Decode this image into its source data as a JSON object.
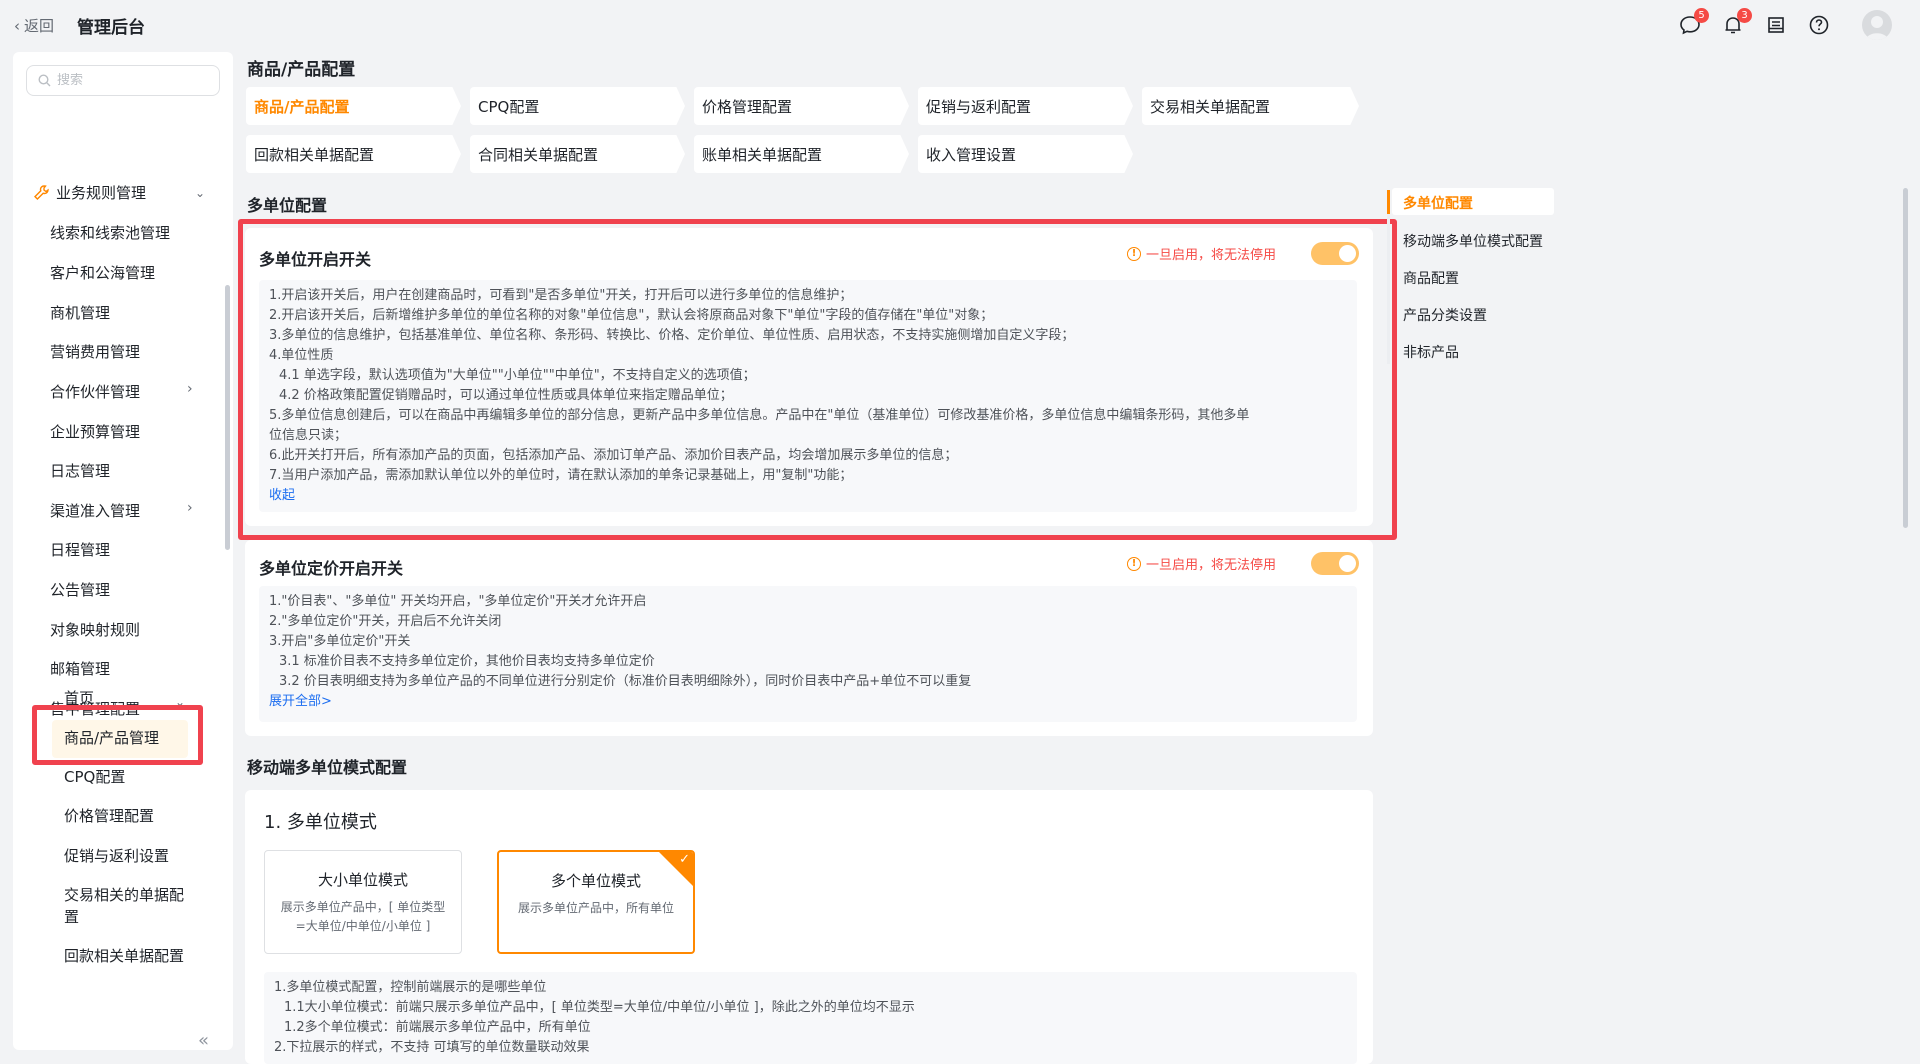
{
  "header": {
    "back_label": "返回",
    "title": "管理后台",
    "icons": [
      {
        "name": "message-icon",
        "badge": "5"
      },
      {
        "name": "bell-icon",
        "badge": "3"
      },
      {
        "name": "task-icon",
        "badge": ""
      },
      {
        "name": "help-icon",
        "badge": ""
      }
    ]
  },
  "sidebar": {
    "search_placeholder": "搜索",
    "group_label": "业务规则管理",
    "items": [
      "线索和线索池管理",
      "客户和公海管理",
      "商机管理",
      "营销费用管理",
      "合作伙伴管理",
      "企业预算管理",
      "日志管理",
      "渠道准入管理",
      "日程管理",
      "公告管理",
      "对象映射规则",
      "邮箱管理",
      "售中管理配置"
    ],
    "sub_items": [
      "首页",
      "商品/产品管理",
      "CPQ配置",
      "价格管理配置",
      "促销与返利设置",
      "交易相关的单据配置",
      "回款相关单据配置"
    ]
  },
  "main": {
    "page_title": "商品/产品配置",
    "tabs": [
      "商品/产品配置",
      "CPQ配置",
      "价格管理配置",
      "促销与返利配置",
      "交易相关单据配置",
      "回款相关单据配置",
      "合同相关单据配置",
      "账单相关单据配置",
      "收入管理设置"
    ],
    "section1_title": "多单位配置",
    "switch1": {
      "title": "多单位开启开关",
      "warning": "一旦启用，将无法停用",
      "enabled": true,
      "lines": [
        "1.开启该开关后，用户在创建商品时，可看到\"是否多单位\"开关，打开后可以进行多单位的信息维护；",
        "2.开启该开关后，后新增维护多单位的单位名称的对象\"单位信息\"，默认会将原商品对象下\"单位\"字段的值存储在\"单位\"对象；",
        "3.多单位的信息维护，包括基准单位、单位名称、条形码、转换比、价格、定价单位、单位性质、启用状态，不支持实施侧增加自定义字段；",
        "4.单位性质",
        "4.1 单选字段，默认选项值为\"大单位\"\"小单位\"\"中单位\"，不支持自定义的选项值；",
        "4.2 价格政策配置促销赠品时，可以通过单位性质或具体单位来指定赠品单位；",
        "5.多单位信息创建后，可以在商品中再编辑多单位的部分信息，更新产品中多单位信息。产品中在\"单位（基准单位）可修改基准价格，多单位信息中编辑条形码，其他多单",
        "位信息只读；",
        "6.此开关打开后，所有添加产品的页面，包括添加产品、添加订单产品、添加价目表产品，均会增加展示多单位的信息；",
        "7.当用户添加产品，需添加默认单位以外的单位时，请在默认添加的单条记录基础上，用\"复制\"功能；"
      ],
      "collapse_label": "收起"
    },
    "switch2": {
      "title": "多单位定价开启开关",
      "warning": "一旦启用，将无法停用",
      "enabled": true,
      "lines": [
        "1.\"价目表\"、\"多单位\" 开关均开启，\"多单位定价\"开关才允许开启",
        "2.\"多单位定价\"开关，开启后不允许关闭",
        "3.开启\"多单位定价\"开关",
        "3.1 标准价目表不支持多单位定价，其他价目表均支持多单位定价",
        "3.2 价目表明细支持为多单位产品的不同单位进行分别定价（标准价目表明细除外），同时价目表中产品+单位不可以重复"
      ],
      "expand_label": "展开全部>"
    },
    "section2_title": "移动端多单位模式配置",
    "mode_heading": "1. 多单位模式",
    "modes": [
      {
        "name": "大小单位模式",
        "desc": "展示多单位产品中，[ 单位类型=大单位/中单位/小单位 ]",
        "selected": false
      },
      {
        "name": "多个单位模式",
        "desc": "展示多单位产品中，所有单位",
        "selected": true
      }
    ],
    "mode_notes": [
      "1.多单位模式配置，控制前端展示的是哪些单位",
      "1.1大小单位模式：前端只展示多单位产品中，[ 单位类型=大单位/中单位/小单位 ]，除此之外的单位均不显示",
      "1.2多个单位模式：前端展示多单位产品中，所有单位",
      "2.下拉展示的样式，不支持 可填写的单位数量联动效果"
    ]
  },
  "anchors": [
    "多单位配置",
    "移动端多单位模式配置",
    "商品配置",
    "产品分类设置",
    "非标产品"
  ],
  "colors": {
    "accent": "#ff8800",
    "highlight": "#f0424e",
    "warning": "#f54a45",
    "link": "#1d6ef0"
  }
}
